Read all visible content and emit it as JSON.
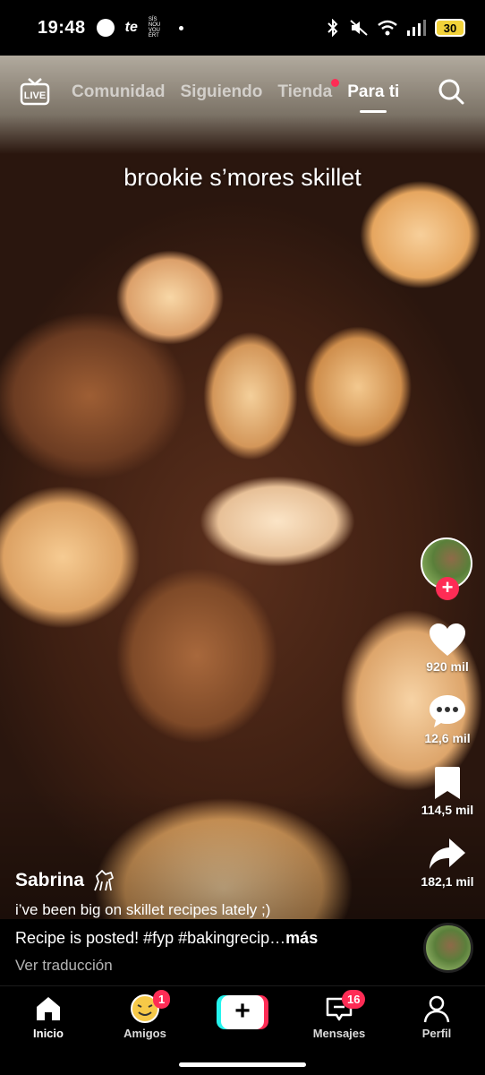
{
  "status_bar": {
    "time": "19:48",
    "carrier": "te",
    "small_text": "SÍS NOU VOU ÉRT",
    "battery": "30"
  },
  "top_nav": {
    "live": "LIVE",
    "tabs": [
      {
        "label": "Comunidad"
      },
      {
        "label": "Siguiendo"
      },
      {
        "label": "Tienda"
      },
      {
        "label": "Para ti"
      }
    ]
  },
  "video": {
    "overlay_text": "brookie s’mores skillet"
  },
  "rail": {
    "likes": "920 mil",
    "comments": "12,6 mil",
    "saves": "114,5 mil",
    "shares": "182,1 mil"
  },
  "post": {
    "username": "Sabrina",
    "description_line1": "i’ve been big on skillet recipes lately ;)",
    "description_line2": "Recipe is posted! #fyp #bakingrecip…",
    "more": "más",
    "translate": "Ver traducción"
  },
  "bottom_nav": {
    "home": "Inicio",
    "friends": "Amigos",
    "friends_badge": "1",
    "create": "+",
    "inbox": "Mensajes",
    "inbox_badge": "16",
    "profile": "Perfil"
  }
}
